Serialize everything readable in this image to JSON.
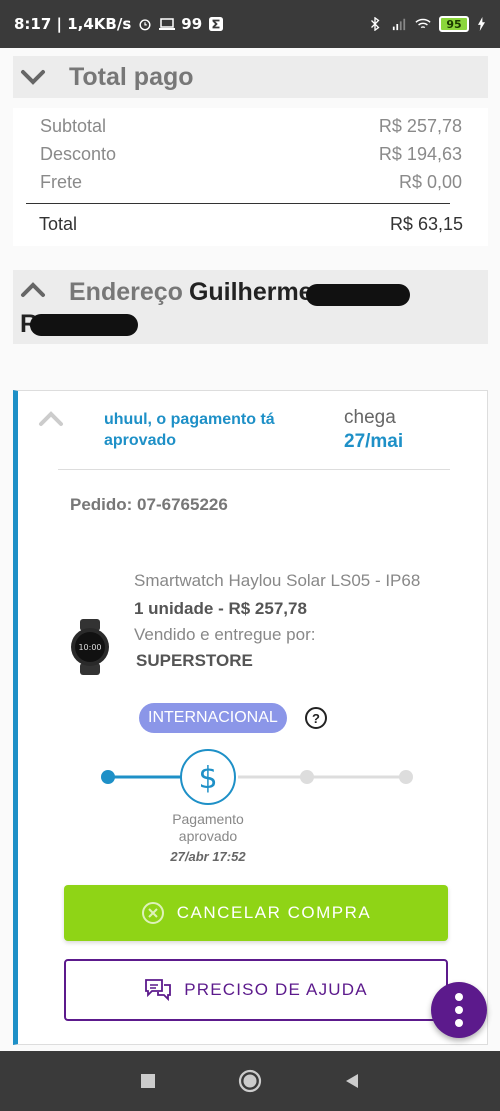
{
  "status_bar": {
    "time_info": "8:17 | 1,4KB/s",
    "notif_count": "99",
    "battery": "95"
  },
  "totals": {
    "title": "Total pago",
    "rows": [
      {
        "label": "Subtotal",
        "value": "R$ 257,78"
      },
      {
        "label": "Desconto",
        "value": "R$ 194,63"
      },
      {
        "label": "Frete",
        "value": "R$ 0,00"
      }
    ],
    "total_label": "Total",
    "total_value": "R$ 63,15"
  },
  "address": {
    "label": "Endereço",
    "name_visible": "Guilherme",
    "second_line_initial": "R"
  },
  "order_card": {
    "status_message": "uhuul, o pagamento tá aprovado",
    "eta_label": "chega",
    "eta_date": "27/mai",
    "order_id": "Pedido: 07-6765226",
    "product_name": "Smartwatch Haylou Solar LS05 - IP68",
    "product_qty_price": "1 unidade - R$ 257,78",
    "seller_label": "Vendido e entregue por:",
    "seller": "SUPERSTORE",
    "badge": "INTERNACIONAL",
    "tracker": {
      "current_step_label": "Pagamento aprovado",
      "current_step_date": "27/abr 17:52",
      "current_step_icon": "dollar-icon",
      "total_steps": 4,
      "current_step_index": 1
    },
    "cancel_button": "CANCELAR COMPRA",
    "help_button": "PRECISO DE AJUDA"
  },
  "colors": {
    "accent_blue": "#1e90c7",
    "cancel_green": "#8fd416",
    "purple": "#5c1a8c",
    "badge_blue": "#8b96e8"
  }
}
